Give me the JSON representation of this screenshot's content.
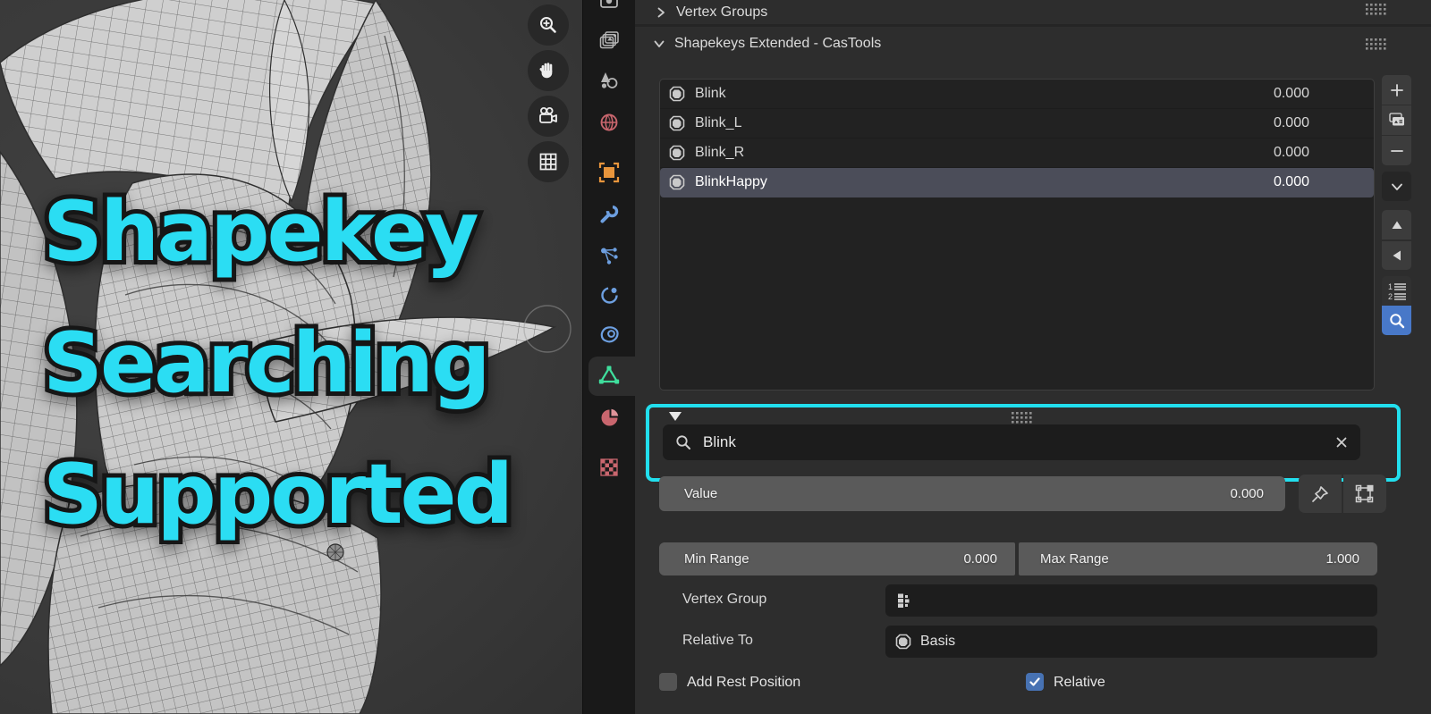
{
  "viewport": {
    "overlay": {
      "lines": [
        "Shapekey",
        "Searching",
        "Supported"
      ],
      "text_color": "#2BDDF3"
    },
    "nav_icons": [
      "zoom-in",
      "pan-hand",
      "camera-view",
      "grid-ortho"
    ]
  },
  "tab_strip": {
    "tabs": [
      "render",
      "view-layer",
      "scene",
      "world",
      "object",
      "modifiers",
      "particles",
      "physics",
      "constraints",
      "object-data",
      "material",
      "texture"
    ],
    "active_tab": "object-data"
  },
  "properties": {
    "vertex_groups_header": {
      "title": "Vertex Groups"
    },
    "shapekeys_header": {
      "title": "Shapekeys Extended - CasTools"
    },
    "list": {
      "items": [
        {
          "name": "Blink",
          "value": "0.000",
          "selected": false
        },
        {
          "name": "Blink_L",
          "value": "0.000",
          "selected": false
        },
        {
          "name": "Blink_R",
          "value": "0.000",
          "selected": false
        },
        {
          "name": "BlinkHappy",
          "value": "0.000",
          "selected": true
        }
      ]
    },
    "side_buttons": [
      "add",
      "specials",
      "remove",
      "menu",
      "move-up",
      "move-left",
      "sort",
      "search"
    ],
    "search": {
      "value": "Blink",
      "highlight_color": "#22DFEE"
    },
    "value_slider": {
      "label": "Value",
      "value": "0.000"
    },
    "min_range": {
      "label": "Min Range",
      "value": "0.000"
    },
    "max_range": {
      "label": "Max Range",
      "value": "1.000"
    },
    "vertex_group": {
      "label": "Vertex Group",
      "value": ""
    },
    "relative_to": {
      "label": "Relative To",
      "value": "Basis"
    },
    "add_rest_position": {
      "label": "Add Rest Position",
      "checked": false
    },
    "relative": {
      "label": "Relative",
      "checked": true
    },
    "selection_color": "#4772B3"
  }
}
